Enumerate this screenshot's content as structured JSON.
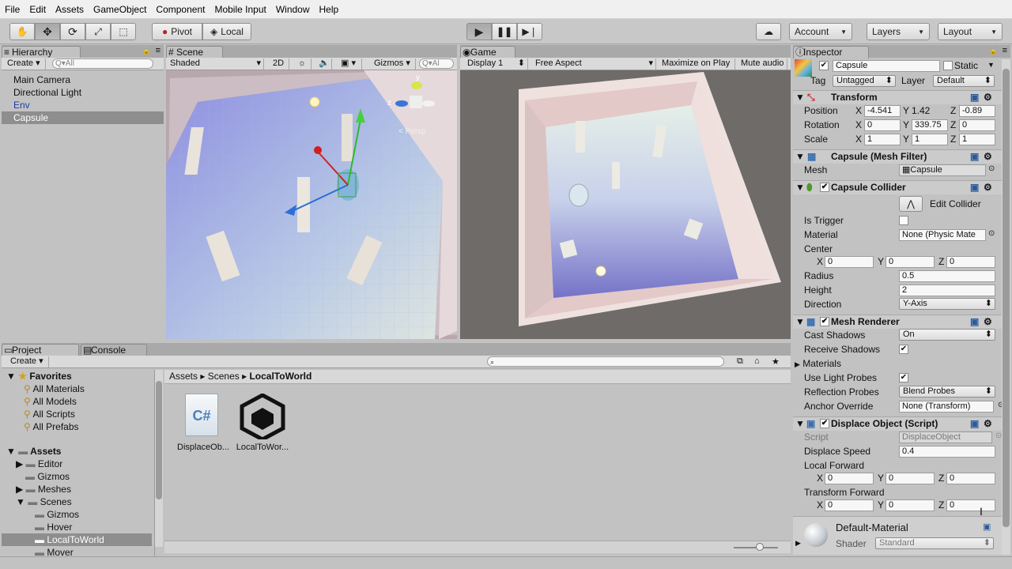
{
  "menu": [
    "File",
    "Edit",
    "Assets",
    "GameObject",
    "Component",
    "Mobile Input",
    "Window",
    "Help"
  ],
  "toolbar": {
    "pivot": "Pivot",
    "local": "Local",
    "account": "Account",
    "layers": "Layers",
    "layout": "Layout"
  },
  "hierarchy": {
    "tab": "Hierarchy",
    "create": "Create",
    "search_placeholder": "Q▾All",
    "items": [
      "Main Camera",
      "Directional Light",
      "Env",
      "Capsule"
    ],
    "selected": "Capsule"
  },
  "scene": {
    "tab": "Scene",
    "shading": "Shaded",
    "mode2d": "2D",
    "gizmos": "Gizmos",
    "search": "Q▾Al",
    "persp": "Persp",
    "axis_y": "y",
    "axis_z": "z"
  },
  "game": {
    "tab": "Game",
    "display": "Display 1",
    "aspect": "Free Aspect",
    "maximize": "Maximize on Play",
    "mute": "Mute audio"
  },
  "project": {
    "tab": "Project",
    "console_tab": "Console",
    "create": "Create",
    "breadcrumb": [
      "Assets",
      "Scenes",
      "LocalToWorld"
    ],
    "favorites_label": "Favorites",
    "favorites": [
      "All Materials",
      "All Models",
      "All Scripts",
      "All Prefabs"
    ],
    "assets_label": "Assets",
    "tree": [
      "Editor",
      "Gizmos",
      "Meshes",
      "Scenes",
      "Gizmos",
      "Hover",
      "LocalToWorld",
      "Mover"
    ],
    "files": [
      {
        "name": "DisplaceOb...",
        "glyph": "C#"
      },
      {
        "name": "LocalToWor..."
      }
    ]
  },
  "inspector": {
    "tab": "Inspector",
    "name": "Capsule",
    "static": "Static",
    "tag_label": "Tag",
    "tag": "Untagged",
    "layer_label": "Layer",
    "layer": "Default",
    "transform": {
      "title": "Transform",
      "position_label": "Position",
      "rotation_label": "Rotation",
      "scale_label": "Scale",
      "position": [
        "-4.541",
        "1.42",
        "-0.89"
      ],
      "rotation": [
        "0",
        "339.75",
        "0"
      ],
      "scale": [
        "1",
        "1",
        "1"
      ]
    },
    "mesh_filter": {
      "title": "Capsule (Mesh Filter)",
      "mesh_label": "Mesh",
      "mesh": "Capsule"
    },
    "collider": {
      "title": "Capsule Collider",
      "edit": "Edit Collider",
      "is_trigger": "Is Trigger",
      "material_label": "Material",
      "material": "None (Physic Mate",
      "center_label": "Center",
      "center": [
        "0",
        "0",
        "0"
      ],
      "radius_label": "Radius",
      "radius": "0.5",
      "height_label": "Height",
      "height": "2",
      "direction_label": "Direction",
      "direction": "Y-Axis"
    },
    "renderer": {
      "title": "Mesh Renderer",
      "cast_label": "Cast Shadows",
      "cast": "On",
      "receive_label": "Receive Shadows",
      "materials_label": "Materials",
      "light_probes_label": "Use Light Probes",
      "reflection_label": "Reflection Probes",
      "reflection": "Blend Probes",
      "anchor_label": "Anchor Override",
      "anchor": "None (Transform)"
    },
    "script": {
      "title": "Displace Object (Script)",
      "script_label": "Script",
      "script": "DisplaceObject",
      "speed_label": "Displace Speed",
      "speed": "0.4",
      "local_label": "Local Forward",
      "local": [
        "0",
        "0",
        "0"
      ],
      "transform_label": "Transform Forward",
      "transform": [
        "0",
        "0",
        "0"
      ]
    },
    "material": {
      "name": "Default-Material",
      "shader_label": "Shader",
      "shader": "Standard"
    },
    "axes": [
      "X",
      "Y",
      "Z"
    ]
  }
}
